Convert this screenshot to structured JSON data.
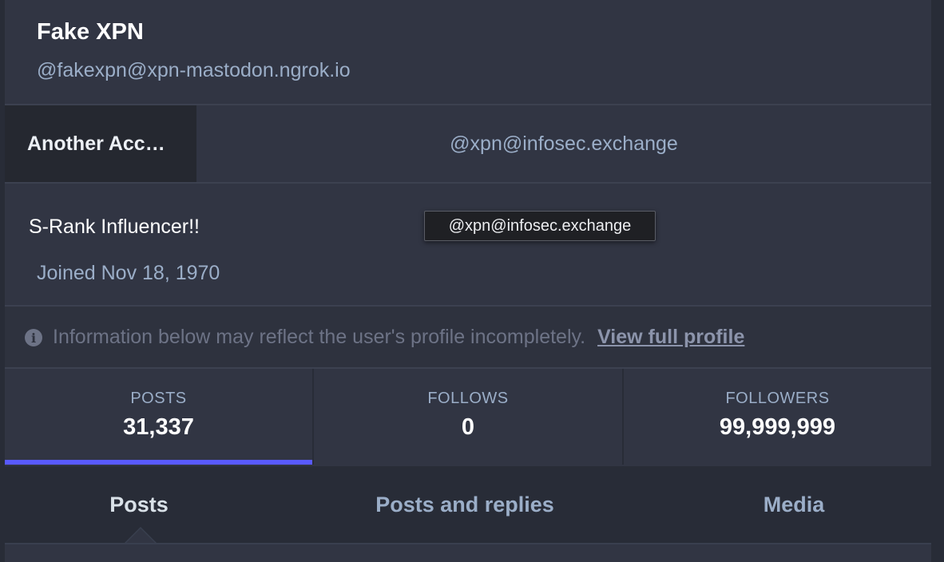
{
  "profile": {
    "display_name": "Fake XPN",
    "acct": "@fakexpn@xpn-mastodon.ngrok.io",
    "fields": [
      {
        "name": "Another Acc…",
        "value": "@xpn@infosec.exchange"
      }
    ],
    "bio": "S-Rank Influencer!!",
    "joined": "Joined Nov 18, 1970"
  },
  "tooltip": {
    "text": "@xpn@infosec.exchange"
  },
  "notice": {
    "icon": "info-circle-icon",
    "text": "Information below may reflect the user's profile incompletely.",
    "link_label": "View full profile"
  },
  "counters": [
    {
      "label": "POSTS",
      "value": "31,337",
      "active": true
    },
    {
      "label": "FOLLOWS",
      "value": "0",
      "active": false
    },
    {
      "label": "FOLLOWERS",
      "value": "99,999,999",
      "active": false
    }
  ],
  "tabs": [
    {
      "label": "Posts",
      "active": true
    },
    {
      "label": "Posts and replies",
      "active": false
    },
    {
      "label": "Media",
      "active": false
    }
  ],
  "colors": {
    "accent": "#595aff",
    "background": "#282c37",
    "panel": "#313543",
    "secondary_text": "#9baec8"
  }
}
